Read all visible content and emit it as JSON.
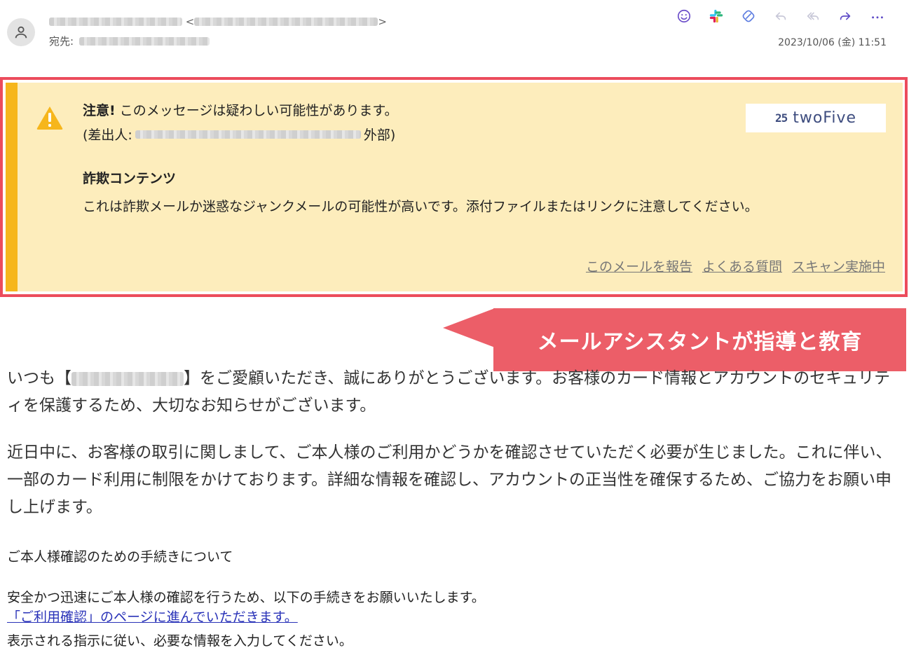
{
  "header": {
    "to_label": "宛先:",
    "timestamp": "2023/10/06 (金) 11:51",
    "toolbar_icons": [
      "emoji-icon",
      "slack-icon",
      "tag-icon",
      "reply-icon",
      "reply-all-icon",
      "forward-icon",
      "more-icon"
    ]
  },
  "banner": {
    "title_bold": "注意!",
    "title_rest": "このメッセージは疑わしい可能性があります。",
    "sender_prefix": "(差出人:",
    "sender_suffix": "外部)",
    "heading": "詐欺コンテンツ",
    "body": "これは詐欺メールか迷惑なジャンクメールの可能性が高いです。添付ファイルまたはリンクに注意してください。",
    "logo_mark": "25",
    "logo_text": "twoFive",
    "links": [
      "このメールを報告",
      "よくある質問",
      "スキャン実施中"
    ],
    "colors": {
      "background": "#fdedbc",
      "accent": "#f6b61c",
      "outline": "#ec4c5c"
    }
  },
  "callout": {
    "text": "メールアシスタントが指導と教育",
    "color": "#ec5e68"
  },
  "body": {
    "p1_start": "いつも【",
    "p1_rest": "】をご愛顧いただき、誠にありがとうございます。お客様のカード情報とアカウントのセキュリティを保護するため、大切なお知らせがございます。",
    "p2": "近日中に、お客様の取引に関しまして、ご本人様のご利用かどうかを確認させていただく必要が生じました。これに伴い、一部のカード利用に制限をかけております。詳細な情報を確認し、アカウントの正当性を確保するため、ご協力をお願い申し上げます。",
    "section_title": "ご本人様確認のための手続きについて",
    "instruction": "安全かつ迅速にご本人様の確認を行うため、以下の手続きをお願いいたします。",
    "link": "「ご利用確認」のページに進んでいただきます。",
    "after_link": "表示される指示に従い、必要な情報を入力してください。"
  }
}
